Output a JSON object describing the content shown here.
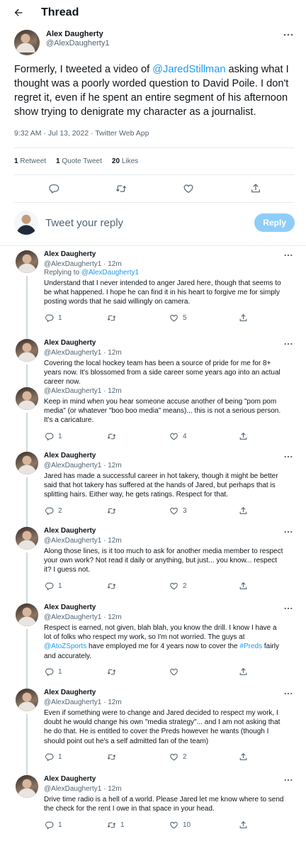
{
  "header": {
    "title": "Thread"
  },
  "main_tweet": {
    "name": "Alex Daugherty",
    "handle": "@AlexDaugherty1",
    "text_before": "Formerly, I tweeted a video of ",
    "mention": "@JaredStillman",
    "text_after": " asking what I thought was a poorly worded question to David Poile. I don't regret it, even if he spent an entire segment of his afternoon show trying to denigrate my character as a journalist.",
    "timestamp": "9:32 AM · Jul 13, 2022 · Twitter Web App",
    "retweets_count": "1",
    "retweets_label": "Retweet",
    "quotes_count": "1",
    "quotes_label": "Quote Tweet",
    "likes_count": "20",
    "likes_label": "Likes"
  },
  "reply_box": {
    "placeholder": "Tweet your reply",
    "button": "Reply"
  },
  "replies": [
    {
      "name": "Alex Daugherty",
      "handle": "@AlexDaugherty1 · 12m",
      "replying_prefix": "Replying to ",
      "replying_to": "@AlexDaugherty1",
      "text": "Understand that I never intended to anger Jared here, though that seems to be what happened. I hope he can find it in his heart to forgive me for simply posting words that he said willingly on camera.",
      "replies": "1",
      "retweets": "",
      "likes": "5"
    },
    {
      "name": "Alex Daugherty",
      "handle": "@AlexDaugherty1 · 12m",
      "text": "Covering the local hockey team has been a source of pride for me for 8+ years now. It's blossomed from a side career some years ago into an actual career now."
    },
    {
      "name": "",
      "handle": "@AlexDaugherty1 · 12m",
      "text": "Keep in mind when you hear someone accuse another of being \"pom pom media\" (or whatever \"boo boo media\" means)... this is not a serious person. It's a caricature.",
      "replies": "1",
      "retweets": "",
      "likes": "4"
    },
    {
      "name": "Alex Daugherty",
      "handle": "@AlexDaugherty1 · 12m",
      "text": "Jared has made a successful career in hot takery, though it might be better said that hot takery has suffered at the hands of Jared, but perhaps that is splitting hairs. Either way, he gets ratings. Respect for that.",
      "replies": "2",
      "retweets": "",
      "likes": "3"
    },
    {
      "name": "Alex Daugherty",
      "handle": "@AlexDaugherty1 · 12m",
      "text": "Along those lines, is it too much to ask for another media member to respect your own work? Not read it daily or anything, but just... you know... respect it? I guess not.",
      "replies": "1",
      "retweets": "",
      "likes": "2"
    },
    {
      "name": "Alex Daugherty",
      "handle": "@AlexDaugherty1 · 12m",
      "text_before": "Respect is earned, not given, blah blah, you know the drill. I know I have a lot of folks who respect my work, so I'm not worried. The guys at ",
      "link1": "@AtoZSports",
      "text_mid": " have employed me for 4 years now to cover the ",
      "link2": "#Preds",
      "text_after": " fairly and accurately.",
      "replies": "1",
      "retweets": "",
      "likes": ""
    },
    {
      "name": "Alex Daugherty",
      "handle": "@AlexDaugherty1 · 12m",
      "text": "Even if something were to change and Jared decided to respect my work, I doubt he would change his own \"media strategy\"... and I am not asking that he do that. He is entitled to cover the Preds however he wants (though I should point out he's a self admitted fan of the team)",
      "replies": "1",
      "retweets": "",
      "likes": "2"
    },
    {
      "name": "Alex Daugherty",
      "handle": "@AlexDaugherty1 · 12m",
      "text": "Drive time radio is a hell of a world. Please Jared let me know where to send the check for the rent I owe in that space in your head.",
      "replies": "1",
      "retweets": "1",
      "likes": "10"
    }
  ],
  "colors": {
    "accent": "#1d9bf0",
    "reply_button": "#8ecdf8",
    "muted": "#536471",
    "text": "#0f1419"
  }
}
